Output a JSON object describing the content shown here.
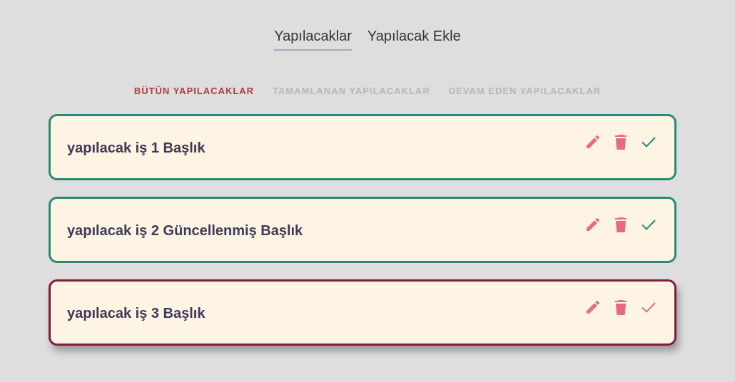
{
  "nav": {
    "items": [
      {
        "label": "Yapılacaklar",
        "active": true
      },
      {
        "label": "Yapılacak Ekle",
        "active": false
      }
    ]
  },
  "filters": [
    {
      "label": "BÜTÜN YAPILACAKLAR",
      "active": true
    },
    {
      "label": "TAMAMLANAN YAPILACAKLAR",
      "active": false
    },
    {
      "label": "DEVAM EDEN YAPILACAKLAR",
      "active": false
    }
  ],
  "todos": [
    {
      "title": "yapılacak iş 1 Başlık",
      "completed": true
    },
    {
      "title": "yapılacak iş 2 Güncellenmiş Başlık",
      "completed": true
    },
    {
      "title": "yapılacak iş 3 Başlık",
      "completed": false
    }
  ],
  "icons": {
    "edit": "pencil-icon",
    "delete": "trash-icon",
    "complete": "check-icon"
  },
  "colors": {
    "background": "#dedede",
    "card": "#fdf4e3",
    "completed_border": "#2a8a73",
    "pending_border": "#7d1d3a",
    "accent_pink": "#e96a80",
    "check_green": "#2a8a73",
    "active_filter": "#b03a40",
    "inactive_filter": "#b7b7b7",
    "title_text": "#3d3a57"
  }
}
